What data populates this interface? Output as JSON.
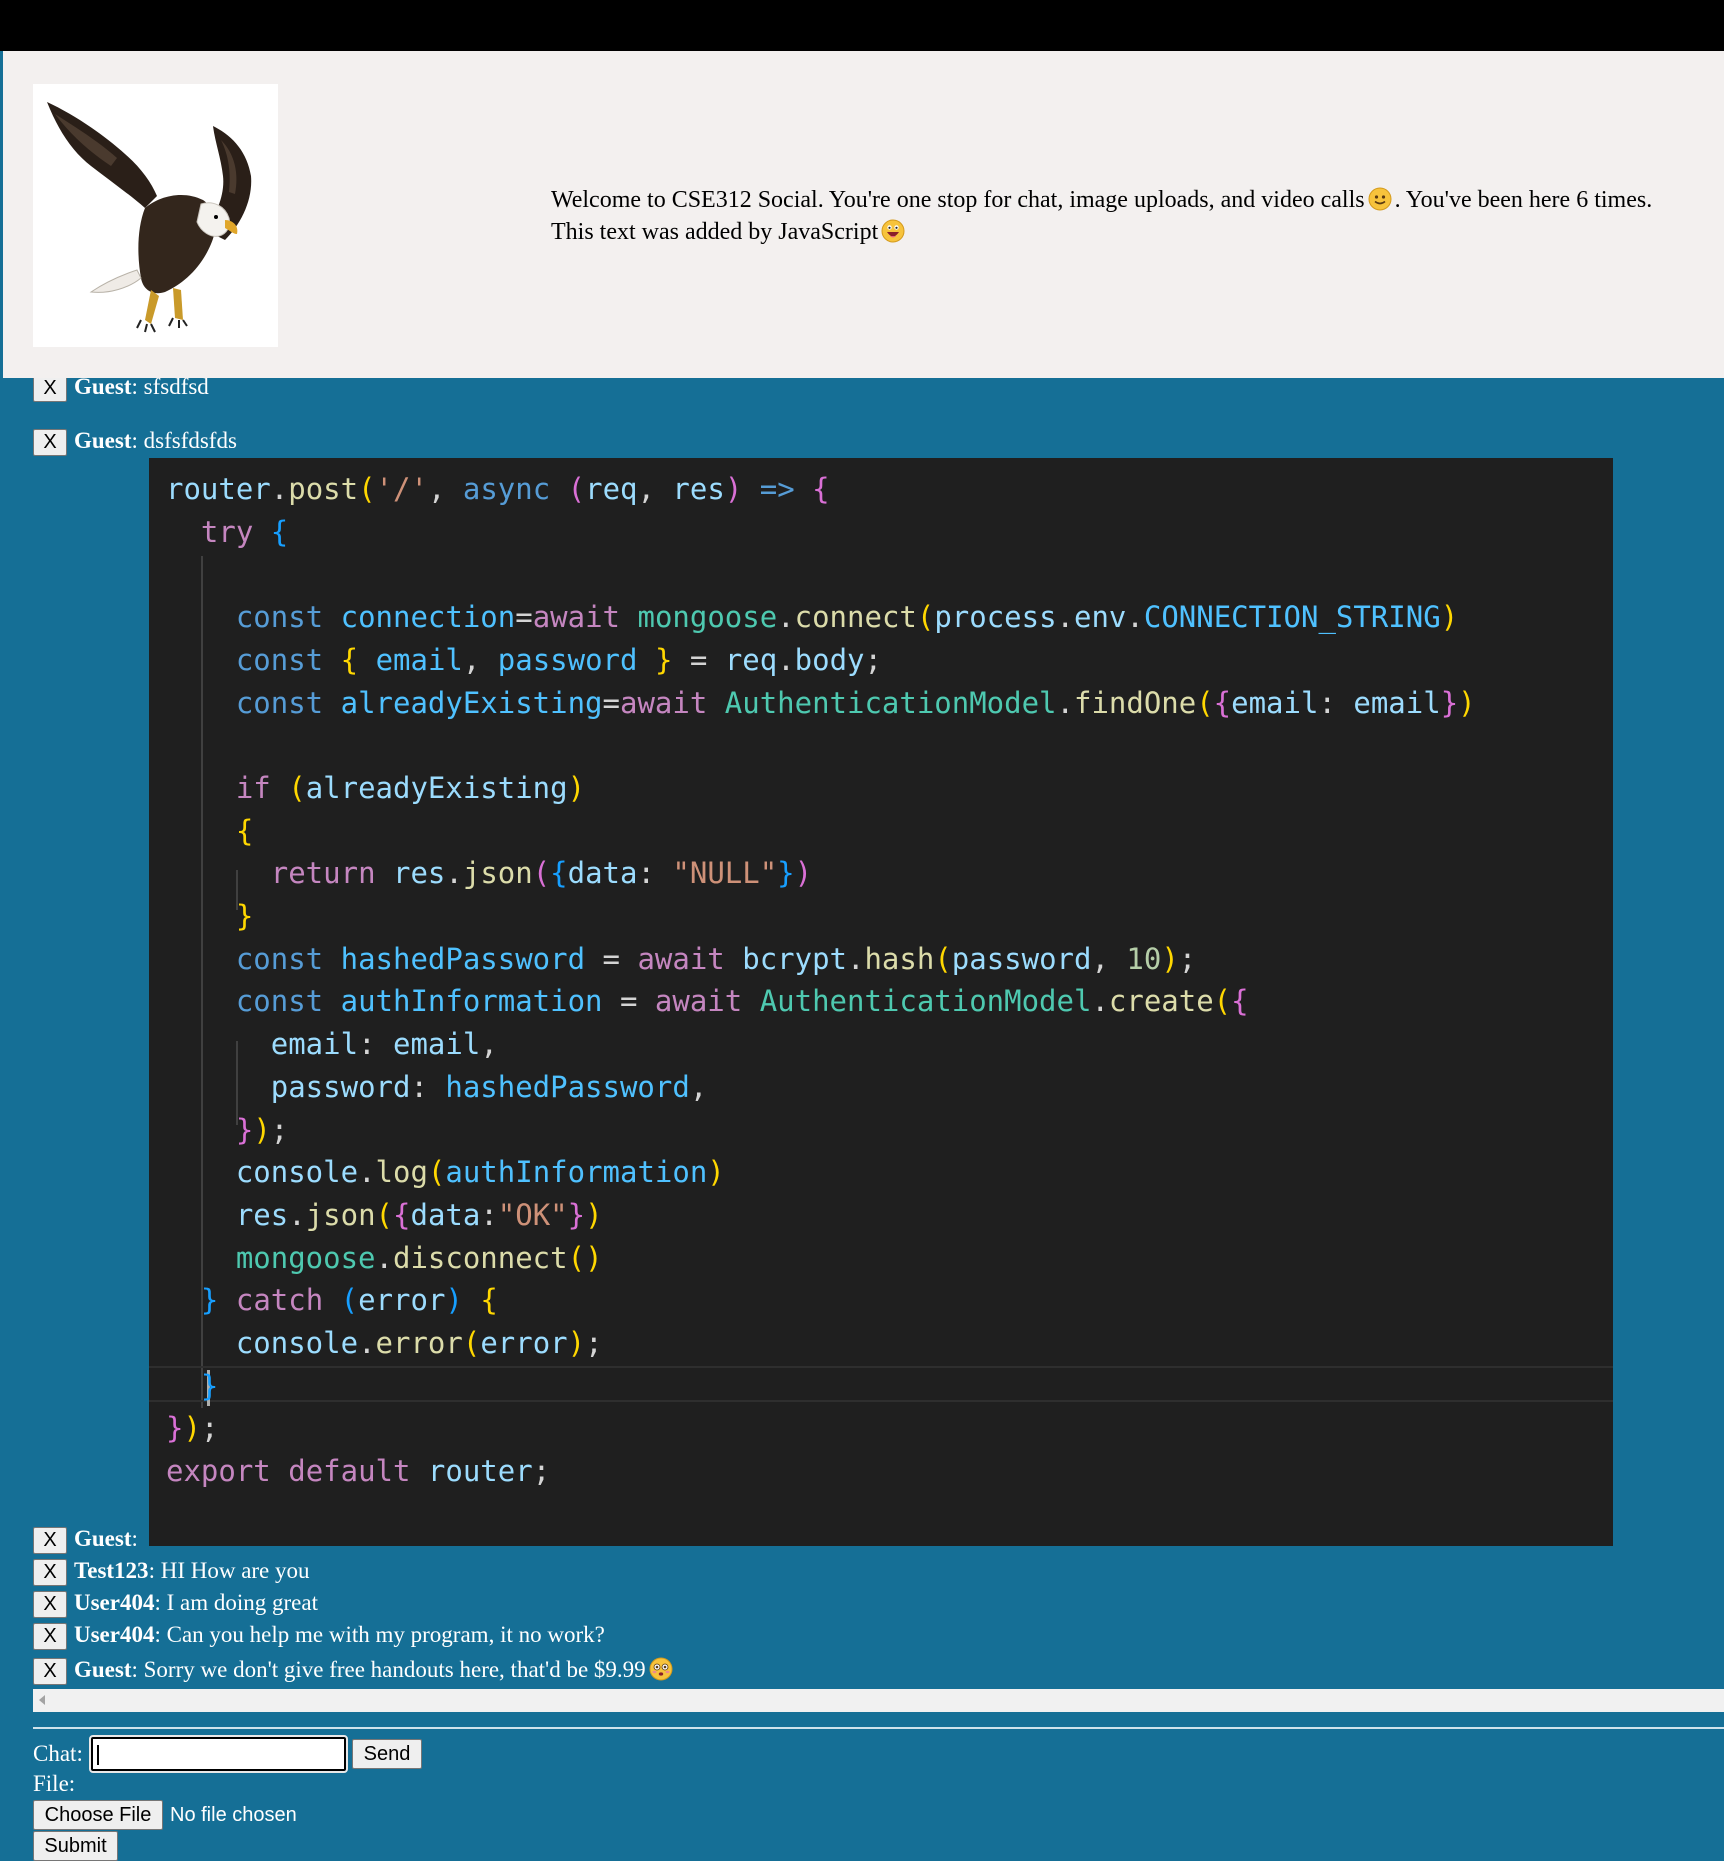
{
  "header": {
    "welcome_line1_a": "Welcome to CSE312 Social. You're one stop for chat, image uploads, and video calls",
    "welcome_line1_b": ". You've been here 6 times.",
    "welcome_line2": "This text was added by JavaScript"
  },
  "messages_top": [
    {
      "delete_label": "X",
      "user": "Guest",
      "text": ": sfsdfsd"
    },
    {
      "delete_label": "X",
      "user": "Guest",
      "text": ": dsfsfdsfds"
    }
  ],
  "messages_bottom": [
    {
      "delete_label": "X",
      "user": "Guest",
      "text": ":"
    },
    {
      "delete_label": "X",
      "user": "Test123",
      "text": ": HI How are you"
    },
    {
      "delete_label": "X",
      "user": "User404",
      "text": ": I am doing great"
    },
    {
      "delete_label": "X",
      "user": "User404",
      "text": ": Can you help me with my program, it no work?"
    },
    {
      "delete_label": "X",
      "user": "Guest",
      "text": ": Sorry we don't give free handouts here, that'd be $9.99"
    }
  ],
  "code_lines": [
    "router.post('/', async (req, res) => {",
    "  try {",
    "",
    "    const connection=await mongoose.connect(process.env.CONNECTION_STRING)",
    "    const { email, password } = req.body;",
    "    const alreadyExisting=await AuthenticationModel.findOne({email: email})",
    "",
    "    if (alreadyExisting)",
    "    {",
    "      return res.json({data: \"NULL\"})",
    "    }",
    "    const hashedPassword = await bcrypt.hash(password, 10);",
    "    const authInformation = await AuthenticationModel.create({",
    "      email: email,",
    "      password: hashedPassword,",
    "    });",
    "    console.log(authInformation)",
    "    res.json({data:\"OK\"})",
    "    mongoose.disconnect()",
    "  } catch (error) {",
    "    console.error(error);",
    "  }",
    "});",
    "export default router;"
  ],
  "form": {
    "chat_label": "Chat:",
    "chat_value": "",
    "send_label": "Send",
    "file_label": "File:",
    "choose_file_label": "Choose File",
    "file_status": "No file chosen",
    "submit_label": "Submit"
  },
  "colors": {
    "page_bg": "#156f96",
    "header_bg": "#f3f0ef",
    "code_bg": "#1f1f1f"
  }
}
